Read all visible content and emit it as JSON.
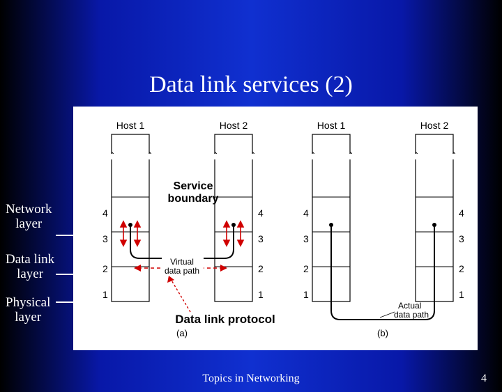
{
  "slide": {
    "title": "Data link services (2)",
    "footer": "Topics in Networking",
    "page_number": "4"
  },
  "side": {
    "network_label_l1": "Network",
    "network_label_l2": "layer",
    "datalink_label_l1": "Data link",
    "datalink_label_l2": "layer",
    "physical_label_l1": "Physical",
    "physical_label_l2": "layer"
  },
  "callouts": {
    "service_l1": "Service",
    "service_l2": "boundary",
    "protocol": "Data link protocol"
  },
  "diagram": {
    "hosts": {
      "h1": "Host 1",
      "h2": "Host 2",
      "h3": "Host 1",
      "h4": "Host 2"
    },
    "layers": {
      "l4": "4",
      "l3": "3",
      "l2": "2",
      "l1": "1"
    },
    "virtual": {
      "l1": "Virtual",
      "l2": "data path"
    },
    "actual": {
      "l1": "Actual",
      "l2": "data path"
    },
    "sub_a": "(a)",
    "sub_b": "(b)"
  }
}
